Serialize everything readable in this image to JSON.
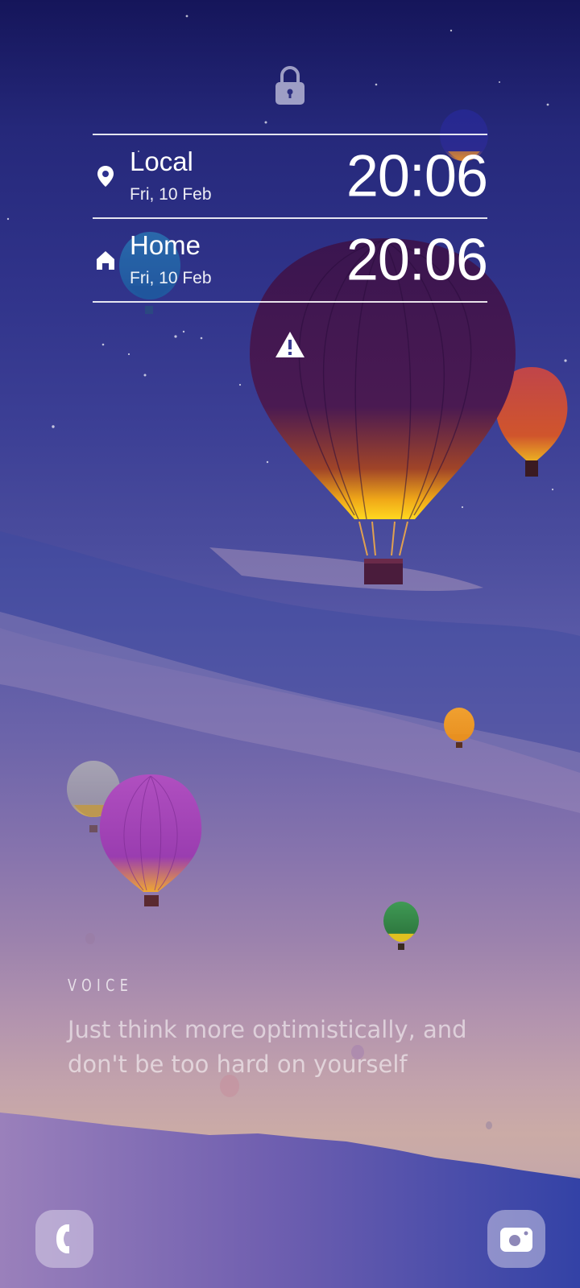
{
  "lockscreen": {
    "lock_icon": "lock-icon",
    "warning_icon": "warning-icon"
  },
  "clocks": [
    {
      "city": "Local",
      "date": "Fri, 10 Feb",
      "time": "20:06",
      "icon": "location-pin-icon"
    },
    {
      "city": "Home",
      "date": "Fri, 10 Feb",
      "time": "20:06",
      "icon": "home-icon"
    }
  ],
  "voice": {
    "label": "VOICE",
    "quote": "Just think more optimistically, and don't be too hard on yourself"
  },
  "shortcuts": {
    "left_icon": "phone-icon",
    "right_icon": "camera-icon"
  },
  "colors": {
    "sky_top": "#15155a",
    "sky_mid": "#5a5aa7",
    "sky_horizon": "#cbaba6",
    "hills": "#6a5aae"
  }
}
